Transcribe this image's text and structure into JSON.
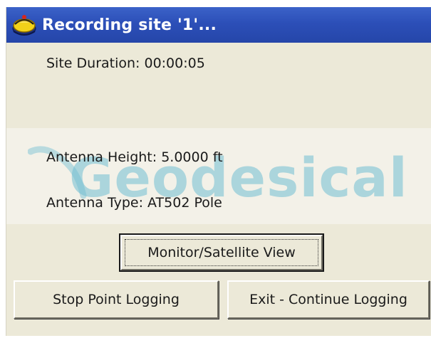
{
  "window": {
    "title": "Recording site '1'..."
  },
  "site": {
    "duration_label": "Site Duration: 00:00:05",
    "antenna_height_label": "Antenna Height: 5.0000 ft",
    "antenna_type_label": "Antenna Type:  AT502 Pole"
  },
  "watermark": {
    "text": "Geodesical"
  },
  "buttons": {
    "monitor_label": "Monitor/Satellite View",
    "stop_label": "Stop Point Logging",
    "exit_label": "Exit - Continue Logging"
  },
  "colors": {
    "titlebar": "#2c4fb8",
    "window_bg": "#ece9d8",
    "watermark": "#70bed2"
  },
  "icons": {
    "app": "satellite-receiver-icon"
  }
}
